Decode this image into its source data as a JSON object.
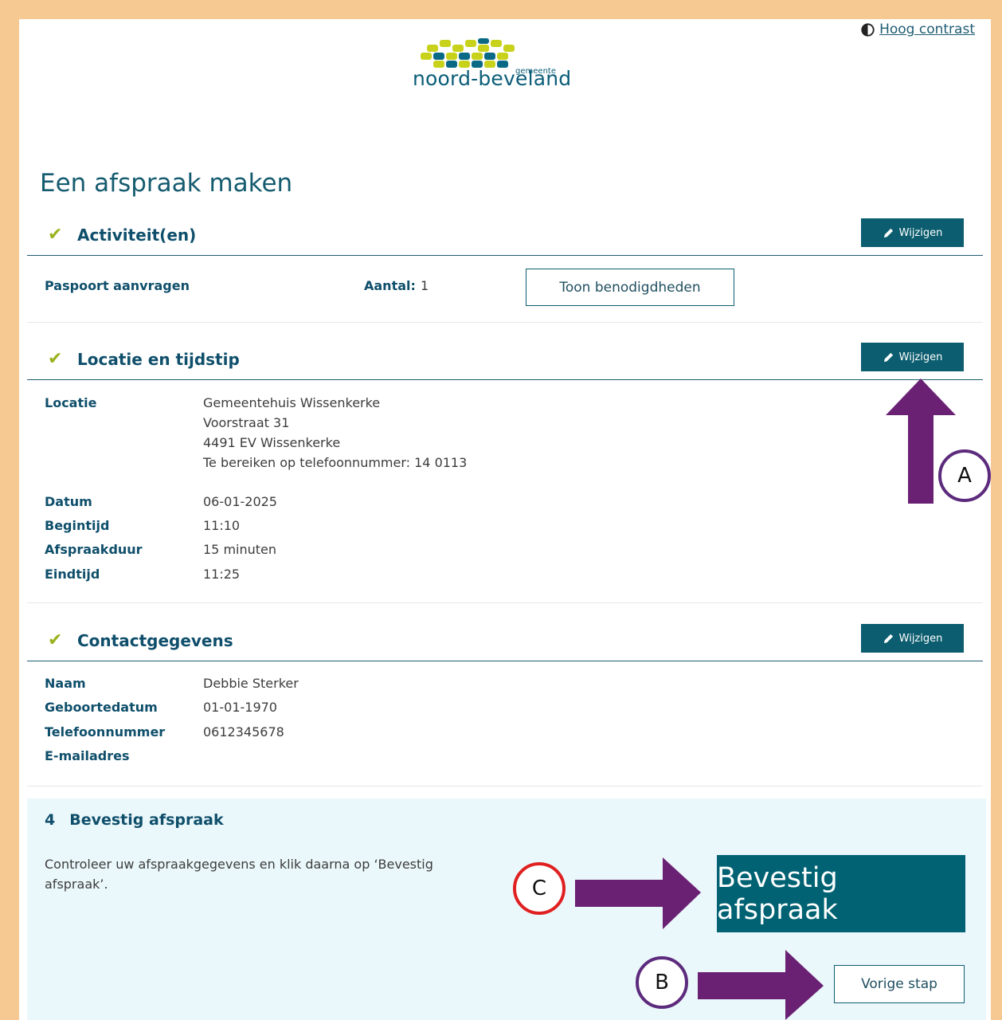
{
  "header": {
    "contrast_label": "Hoog contrast",
    "logo_wordmark": "noord-beveland",
    "logo_sub": "gemeente"
  },
  "page_title": "Een afspraak maken",
  "sections": {
    "activities": {
      "title": "Activiteit(en)",
      "edit_label": "Wijzigen",
      "item_name": "Paspoort aanvragen",
      "count_label": "Aantal:",
      "count_value": "1",
      "requirements_button": "Toon benodigdheden"
    },
    "location": {
      "title": "Locatie en tijdstip",
      "edit_label": "Wijzigen",
      "location_label": "Locatie",
      "location_lines": [
        "Gemeentehuis Wissenkerke",
        "Voorstraat 31",
        "4491 EV Wissenkerke",
        "Te bereiken op telefoonnummer: 14 0113"
      ],
      "date_label": "Datum",
      "date_value": "06-01-2025",
      "start_label": "Begintijd",
      "start_value": "11:10",
      "duration_label": "Afspraakduur",
      "duration_value": "15 minuten",
      "end_label": "Eindtijd",
      "end_value": "11:25"
    },
    "contact": {
      "title": "Contactgegevens",
      "edit_label": "Wijzigen",
      "name_label": "Naam",
      "name_value": "Debbie Sterker",
      "dob_label": "Geboortedatum",
      "dob_value": "01-01-1970",
      "phone_label": "Telefoonnummer",
      "phone_value": "0612345678",
      "email_label": "E-mailadres",
      "email_value": ""
    },
    "confirm": {
      "step_number": "4",
      "title": "Bevestig afspraak",
      "description": "Controleer uw afspraakgegevens en klik daarna op ‘Bevestig afspraak’.",
      "confirm_button": "Bevestig afspraak",
      "back_button": "Vorige stap"
    }
  },
  "annotations": {
    "a": "A",
    "b": "B",
    "c": "C"
  },
  "colors": {
    "accent": "#0b5d6f",
    "heading": "#0f4f6b",
    "check": "#9ab21e",
    "arrow": "#6a2174",
    "frame": "#f5c991",
    "confirm_bg": "#ebf8fb"
  }
}
